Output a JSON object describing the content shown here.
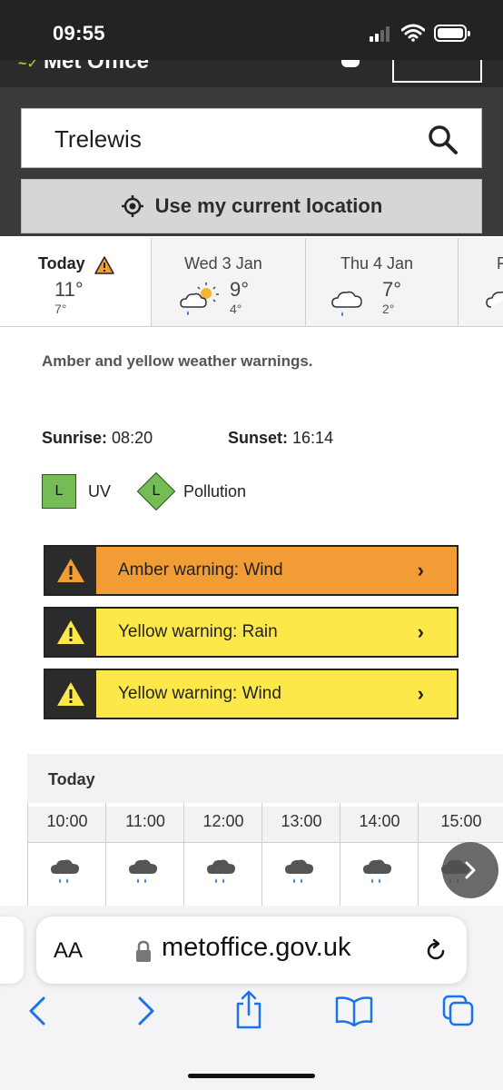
{
  "status_bar": {
    "time": "09:55"
  },
  "header": {
    "brand": "Met Office"
  },
  "search": {
    "value": "Trelewis",
    "use_location_label": "Use my current location"
  },
  "days": [
    {
      "label": "Today",
      "high": "11°",
      "low": "7°",
      "warning": true
    },
    {
      "label": "Wed 3 Jan",
      "high": "9°",
      "low": "4°",
      "icon": "sun-cloud-rain-icon"
    },
    {
      "label": "Thu 4 Jan",
      "high": "7°",
      "low": "2°",
      "icon": "cloud-rain-icon"
    },
    {
      "label": "F",
      "icon": "cloud-icon"
    }
  ],
  "warning_summary": "Amber and yellow weather warnings.",
  "sun": {
    "sunrise_label": "Sunrise:",
    "sunrise": "08:20",
    "sunset_label": "Sunset:",
    "sunset": "16:14"
  },
  "indices": {
    "uv_level": "L",
    "uv_label": "UV",
    "pollution_level": "L",
    "pollution_label": "Pollution"
  },
  "warnings": [
    {
      "text": "Amber warning: Wind",
      "color": "#f19c34"
    },
    {
      "text": "Yellow warning: Rain",
      "color": "#fde84a"
    },
    {
      "text": "Yellow warning: Wind",
      "color": "#fde84a"
    }
  ],
  "hourly": {
    "title": "Today",
    "hours": [
      "10:00",
      "11:00",
      "12:00",
      "13:00",
      "14:00",
      "15:00"
    ]
  },
  "browser": {
    "aa_label": "AA",
    "url": "metoffice.gov.uk"
  }
}
